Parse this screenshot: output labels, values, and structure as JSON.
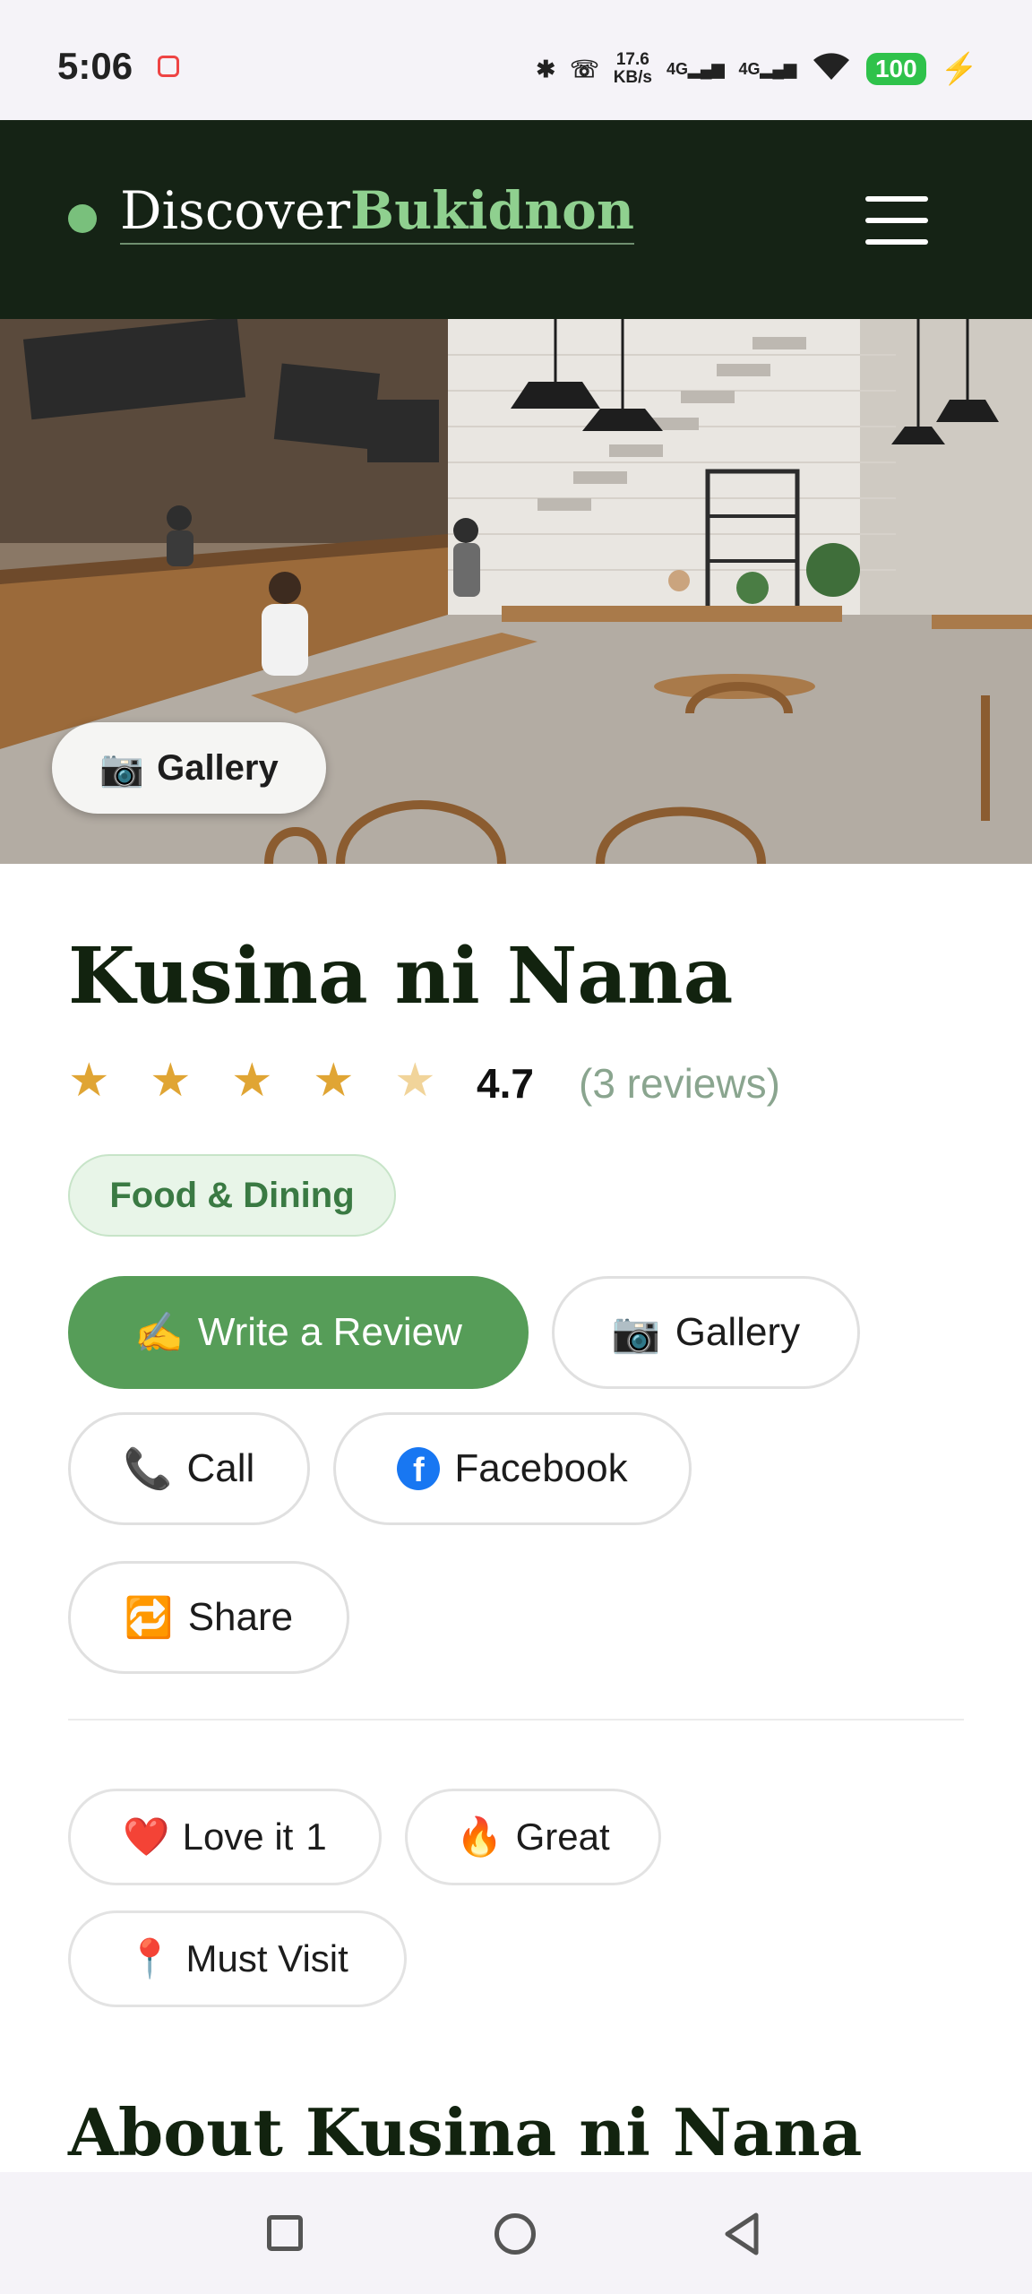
{
  "status_bar": {
    "time": "5:06",
    "net_speed_value": "17.6",
    "net_speed_unit": "KB/s",
    "signal1": "4G",
    "signal2": "4G",
    "battery": "100"
  },
  "header": {
    "logo_part1": "Discover",
    "logo_part2": "Bukidnon",
    "menu_icon": "hamburger-menu-icon"
  },
  "hero": {
    "gallery_label": "Gallery",
    "gallery_icon": "📷"
  },
  "place": {
    "name": "Kusina ni Nana",
    "rating": "4.7",
    "reviews": "(3 reviews)",
    "stars_filled": 4,
    "stars_total": 5,
    "category": "Food & Dining"
  },
  "actions": {
    "write_review": {
      "icon": "✍",
      "label": "Write a Review"
    },
    "gallery": {
      "icon": "📷",
      "label": "Gallery"
    },
    "call": {
      "icon": "📞",
      "label": "Call"
    },
    "facebook": {
      "icon": "f",
      "label": "Facebook"
    },
    "share": {
      "icon": "🔁",
      "label": "Share"
    }
  },
  "reactions": {
    "love": {
      "icon": "❤️",
      "label": "Love it",
      "count": "1"
    },
    "great": {
      "icon": "🔥",
      "label": "Great"
    },
    "must_visit": {
      "icon": "📍",
      "label": "Must Visit"
    }
  },
  "about_title": "About Kusina ni Nana",
  "colors": {
    "header_bg": "#152315",
    "accent_green": "#569d58",
    "star": "#e0a534"
  }
}
